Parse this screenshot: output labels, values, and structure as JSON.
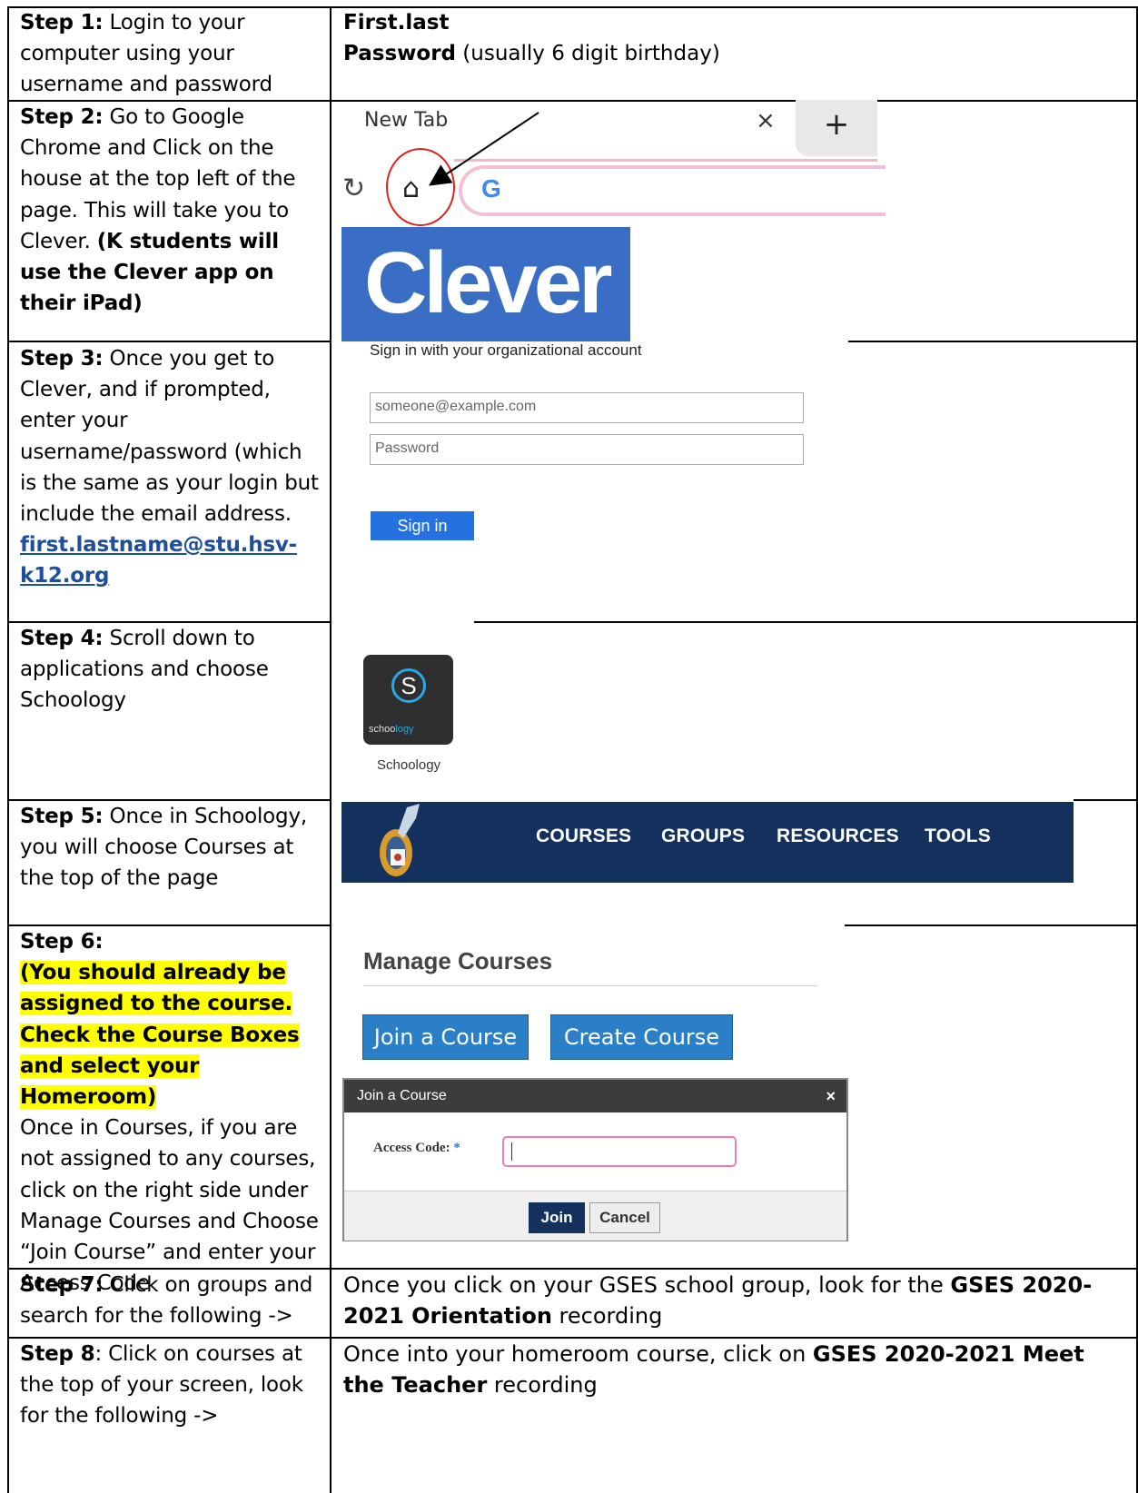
{
  "rows": [
    {
      "step": "Step 1:",
      "text": " Login to your computer using your username and password"
    },
    {
      "step": "Step 2:",
      "text": " Go to Google Chrome and Click on the house at the top left of the page.  This will take you to Clever. ",
      "bold_note": "(K students will use the Clever app on their iPad)"
    },
    {
      "step": "Step 3:",
      "text": " Once you get to Clever, and if prompted, enter your username/password (which is the same as your login but include the email address. ",
      "link": "first.lastname@stu.hsv-k12.org"
    },
    {
      "step": "Step 4:",
      "text": " Scroll down to applications and choose Schoology"
    },
    {
      "step": "Step 5:",
      "text": " Once in Schoology, you will choose Courses at the top of the page"
    },
    {
      "step": "Step 6:",
      "highlight": "(You should already be assigned to the course. Check the Course Boxes and select your Homeroom)",
      "text": "Once in Courses, if you are not assigned to any courses, click on the right side under Manage Courses and Choose “Join Course” and enter your Access Code"
    },
    {
      "step": "Step 7:",
      "text": " Click on groups and search for the following ->"
    },
    {
      "step": "Step 8",
      "text": ": Click on courses at the top of your screen, look for the following ->"
    }
  ],
  "step1_right": {
    "line1": "First.last",
    "pw_bold": "Password",
    "pw_rest": " (usually 6 digit birthday)"
  },
  "browser": {
    "tab_title": "New Tab",
    "close": "×",
    "plus": "+",
    "reload": "↻",
    "home": "⌂",
    "g": "G"
  },
  "clever": {
    "word": "Clever"
  },
  "signin": {
    "title": "Sign in with your organizational account",
    "email_placeholder": "someone@example.com",
    "password_placeholder": "Password",
    "button": "Sign in"
  },
  "schoology": {
    "small": "schoo",
    "small2": "logy",
    "s": "S",
    "label": "Schoology"
  },
  "nav": {
    "courses": "COURSES",
    "groups": "GROUPS",
    "resources": "RESOURCES",
    "tools": "TOOLS"
  },
  "manage": {
    "title": "Manage Courses",
    "join": "Join a Course",
    "create": "Create Course",
    "dialog_title": "Join a Course",
    "dialog_close": "×",
    "access_label": "Access Code:",
    "required": " *",
    "join_btn": "Join",
    "cancel_btn": "Cancel"
  },
  "step7_right": {
    "pre": "Once you click on your GSES school group, look for the ",
    "bold": "GSES 2020-2021 Orientation",
    "post": " recording"
  },
  "step8_right": {
    "pre": "Once into your homeroom course, click on ",
    "bold": "GSES 2020-2021 Meet the Teacher",
    "post": " recording"
  }
}
